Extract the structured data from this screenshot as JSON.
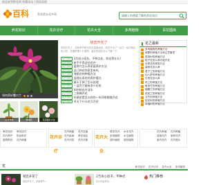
{
  "topbar": {
    "text": "欢迎来到鲜花网 收藏本站 | 网站导航"
  },
  "header": {
    "logo_text": "百科",
    "slogan": "养花就去花卉网",
    "search_placeholder": "请输入你想要了解的养花知识",
    "brand_color": "#f29400",
    "accent_color": "#3f9e47"
  },
  "nav": {
    "items": [
      "养花知识",
      "花卉诊疗",
      "花卉大全",
      "多肉植物",
      "百花图库"
    ]
  },
  "hero": {
    "caption": "如何养好蟹爪兰"
  },
  "center": {
    "headline": "韧恋开花了",
    "summary": "韧恋开花了，初秋季节阳光充足温度适宜，韧恋开出了一朵又一朵的紫红色小花，花瓣舒展十分美丽，喜欢的朋友可以了解一下。",
    "list": [
      {
        "tag": "花卉知识",
        "title": "3月份小阳台，不种点花，你还等什么？"
      },
      {
        "tag": "花卉知识",
        "title": "新手不养这些花卉"
      },
      {
        "tag": "花卉知识",
        "title": "富贵竹怎么养家庭养护方法"
      },
      {
        "tag": "花卉知识",
        "title": "这几种花你家里有吗"
      },
      {
        "tag": "花卉知识",
        "title": "海棠花的种植方法"
      },
      {
        "tag": "花卉知识",
        "title": "盆栽长寿花的养护要点"
      },
      {
        "tag": "花卉知识",
        "title": "春天干掉了怎么处理"
      },
      {
        "tag": "花卉知识",
        "title": "一盆吊兰能有多少好处"
      },
      {
        "tag": "花卉知识",
        "title": "如何给花卉浇水"
      },
      {
        "tag": "花卉知识",
        "title": "三角梅开花"
      },
      {
        "tag": "花卉知识",
        "title": "杜鹃花是怎么样的一年四季都能开花"
      },
      {
        "tag": "花卉知识",
        "title": "冬天下什么花又开花"
      }
    ]
  },
  "sidebar": {
    "title": "花之最新",
    "items": [
      "多肉植物的养殖方法",
      "绿萝的养殖方法和注意事项",
      "发财树的养殖方法",
      "栀子花怎么养才能开花",
      "月季花的修剪方法",
      "茉莉花怎么养",
      "君子兰的养殖方法",
      "仙人掌的养殖方法",
      "长寿花怎么养",
      "吊兰的养殖方法",
      "龟背竹的养殖方法",
      "蝴蝶兰的养殖方法",
      "虎皮兰的养殖方法",
      "文竹的养殖方法",
      "桂花树的养殖方法",
      "幸福树的养殖方法"
    ]
  },
  "thumbs": [
    {
      "caption": "盆栽绿植"
    },
    {
      "caption": "玫瑰花"
    },
    {
      "caption": "花卉图片大全"
    }
  ],
  "categories": {
    "block1": {
      "links": [
        "养花知识",
        "养花技巧",
        "花卉养护",
        "阳台种花",
        "庭院种花",
        "花卉病害"
      ]
    },
    "block2": {
      "label": "花卉诊疗",
      "links": [
        "花卉病害",
        "花卉虫害",
        "花卉疾病",
        "养花误区",
        "花卉问答",
        "花卉诊断"
      ]
    },
    "block3": {
      "label": "花卉大全",
      "links": [
        "草本花卉",
        "木本花卉",
        "多肉植物",
        "水生植物",
        "观叶植物",
        "观花植物"
      ]
    },
    "block4": {
      "links": [
        "花卉养殖",
        "花卉种植",
        "盆栽花卉",
        "家养花卉",
        "室内花卉",
        "花卉图片"
      ]
    }
  },
  "section": {
    "title": "花",
    "tabs": [
      "养花知识",
      "花卉诊疗",
      "花卉大全",
      "多肉植物"
    ]
  },
  "bottom": {
    "item1": {
      "title": "韧恋开花了",
      "text": "韧恋开花了，初秋季节…"
    },
    "item2": {
      "title": "2万块小房子，不种点",
      "text": "在小阳台养花…"
    },
    "hot_title": "热门推荐"
  }
}
